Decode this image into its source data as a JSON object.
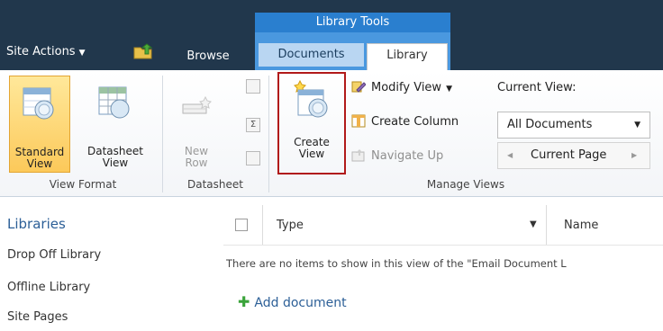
{
  "topbar": {
    "site_actions": "Site Actions",
    "tabs": {
      "browse": "Browse",
      "documents": "Documents",
      "library": "Library"
    },
    "contextual_group": "Library Tools"
  },
  "ribbon": {
    "view_format": {
      "label": "View Format",
      "standard_view": [
        "Standard",
        "View"
      ],
      "datasheet_view": [
        "Datasheet",
        "View"
      ]
    },
    "datasheet": {
      "label": "Datasheet",
      "new_row": [
        "New",
        "Row"
      ]
    },
    "manage_views": {
      "label": "Manage Views",
      "create_view": [
        "Create",
        "View"
      ],
      "modify_view": "Modify View",
      "create_column": "Create Column",
      "navigate_up": "Navigate Up",
      "current_view_label": "Current View:",
      "current_view_value": "All Documents",
      "current_page": "Current Page"
    }
  },
  "nav": {
    "heading": "Libraries",
    "items": [
      "Drop Off Library",
      "Offline Library",
      "Site Pages"
    ]
  },
  "list": {
    "columns": [
      "Type",
      "Name"
    ],
    "empty_message": "There are no items to show in this view of the \"Email Document L",
    "add_document": "Add document"
  },
  "colors": {
    "topbar_bg": "#21374c",
    "contextual_tab": "#2a7fcf",
    "selected_button": "#fcc95a",
    "highlight_border": "#b11a1a",
    "link_blue": "#2c5f97"
  }
}
